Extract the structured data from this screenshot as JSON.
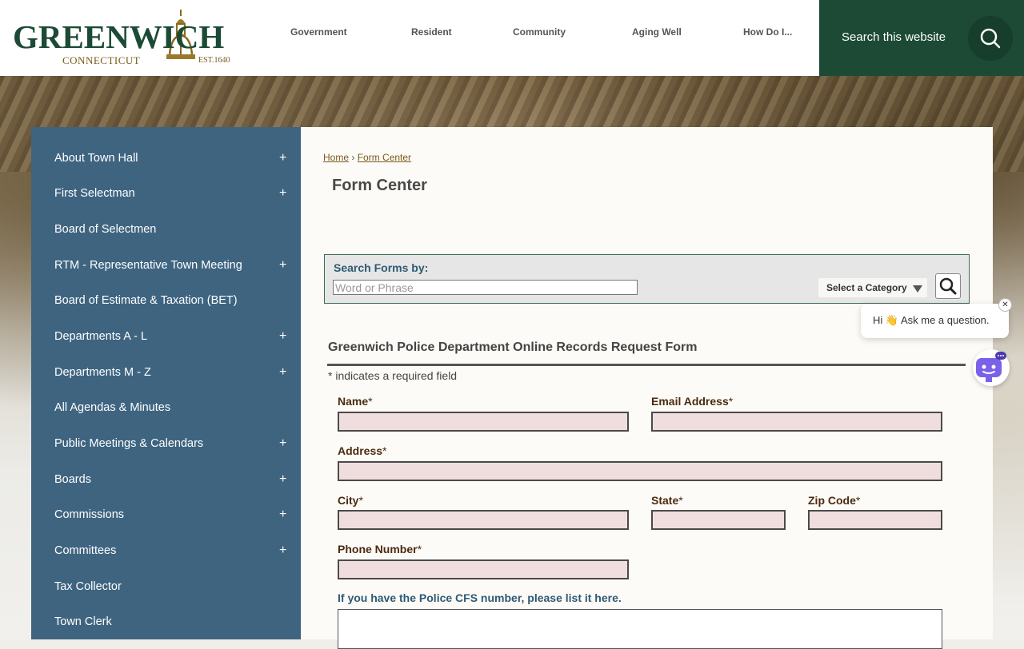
{
  "logo": {
    "wordmark": "GREENWICH",
    "state": "CONNECTICUT",
    "established": "EST.1640"
  },
  "nav": {
    "items": [
      "Government",
      "Resident",
      "Community",
      "Aging Well",
      "How Do I..."
    ]
  },
  "site_search": {
    "placeholder": "Search this website",
    "icon": "search-icon"
  },
  "sidebar": {
    "items": [
      {
        "label": "About Town Hall",
        "expand": "+"
      },
      {
        "label": "First Selectman",
        "expand": "+"
      },
      {
        "label": "Board of Selectmen",
        "expand": ""
      },
      {
        "label": "RTM - Representative Town Meeting",
        "expand": "+"
      },
      {
        "label": "Board of Estimate & Taxation (BET)",
        "expand": ""
      },
      {
        "label": "Departments A - L",
        "expand": "+"
      },
      {
        "label": "Departments M - Z",
        "expand": "+"
      },
      {
        "label": "All Agendas & Minutes",
        "expand": ""
      },
      {
        "label": "Public Meetings & Calendars",
        "expand": "+"
      },
      {
        "label": "Boards",
        "expand": "+"
      },
      {
        "label": "Commissions",
        "expand": "+"
      },
      {
        "label": "Committees",
        "expand": "+"
      },
      {
        "label": "Tax Collector",
        "expand": ""
      },
      {
        "label": "Town Clerk",
        "expand": ""
      }
    ]
  },
  "breadcrumb": {
    "home": "Home",
    "separator": "›",
    "current": "Form Center"
  },
  "page": {
    "title": "Form Center"
  },
  "search_forms": {
    "label": "Search Forms by:",
    "placeholder": "Word or Phrase",
    "category_label": "Select a Category"
  },
  "form": {
    "title": "Greenwich Police Department Online Records Request Form",
    "required_note": "* indicates a required field",
    "required_marker": "*",
    "fields": {
      "name": "Name",
      "email": "Email Address",
      "address": "Address",
      "city": "City",
      "state": "State",
      "zip": "Zip Code",
      "phone": "Phone Number"
    },
    "cfs_label": "If you have the Police CFS number, please list it here."
  },
  "chat": {
    "message": "Hi 👋 Ask me a question.",
    "close": "✕"
  },
  "colors": {
    "brand_green": "#1c4a35",
    "sidebar_blue": "#3e6480",
    "field_fill": "#f0dede",
    "link_brown": "#7a5a1a"
  }
}
